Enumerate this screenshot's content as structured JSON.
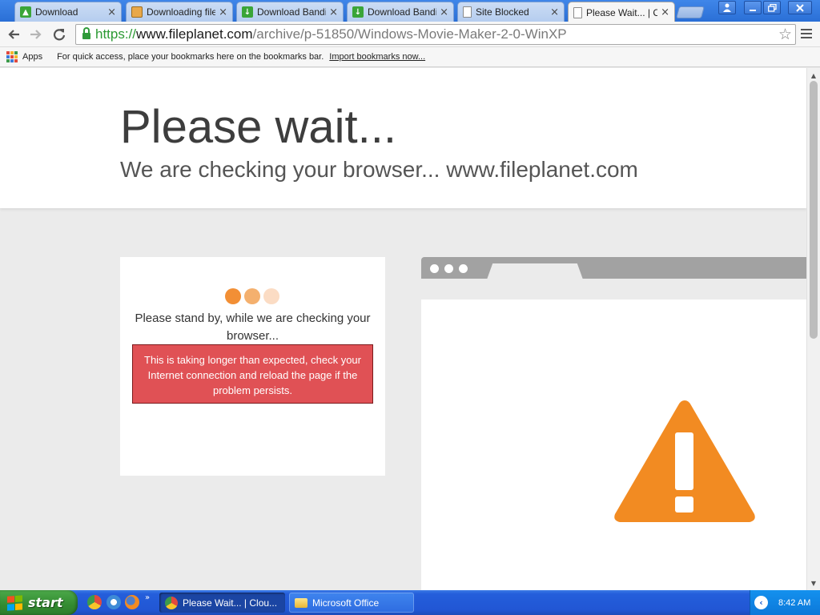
{
  "browser": {
    "tabs": [
      {
        "title": "Download",
        "icon": "green-arrow-icon"
      },
      {
        "title": "Downloading file |",
        "icon": "multi-page-icon"
      },
      {
        "title": "Download Bandicam",
        "icon": "download-green-icon"
      },
      {
        "title": "Download Bandicam",
        "icon": "download-green-icon"
      },
      {
        "title": "Site Blocked",
        "icon": "page-icon"
      },
      {
        "title": "Please Wait... | C",
        "icon": "page-icon",
        "active": true
      }
    ],
    "tab_close_glyph": "×",
    "url_scheme": "https://",
    "url_host": "www.fileplanet.com",
    "url_path": "/archive/p-51850/Windows-Movie-Maker-2-0-WinXP"
  },
  "bookmarks": {
    "apps_label": "Apps",
    "hint": "For quick access, place your bookmarks here on the bookmarks bar.",
    "import_link": "Import bookmarks now..."
  },
  "page": {
    "title": "Please wait...",
    "subtitle": "We are checking your browser... www.fileplanet.com",
    "standby_text": "Please stand by, while we are checking your browser...",
    "alert_text": "This is taking longer than expected, check your Internet connection and reload the page if the problem persists.",
    "colors": {
      "loader_dots": [
        "#f28f35",
        "#f4b06e",
        "#fbdcc4"
      ],
      "alert_bg": "#e05155",
      "warning": "#f28b22"
    }
  },
  "taskbar": {
    "start_label": "start",
    "tasks": [
      {
        "label": "Please Wait... | Clou...",
        "active": true
      },
      {
        "label": "Microsoft Office",
        "active": false
      }
    ],
    "more_glyph": "»",
    "clock": "8:42 AM"
  }
}
